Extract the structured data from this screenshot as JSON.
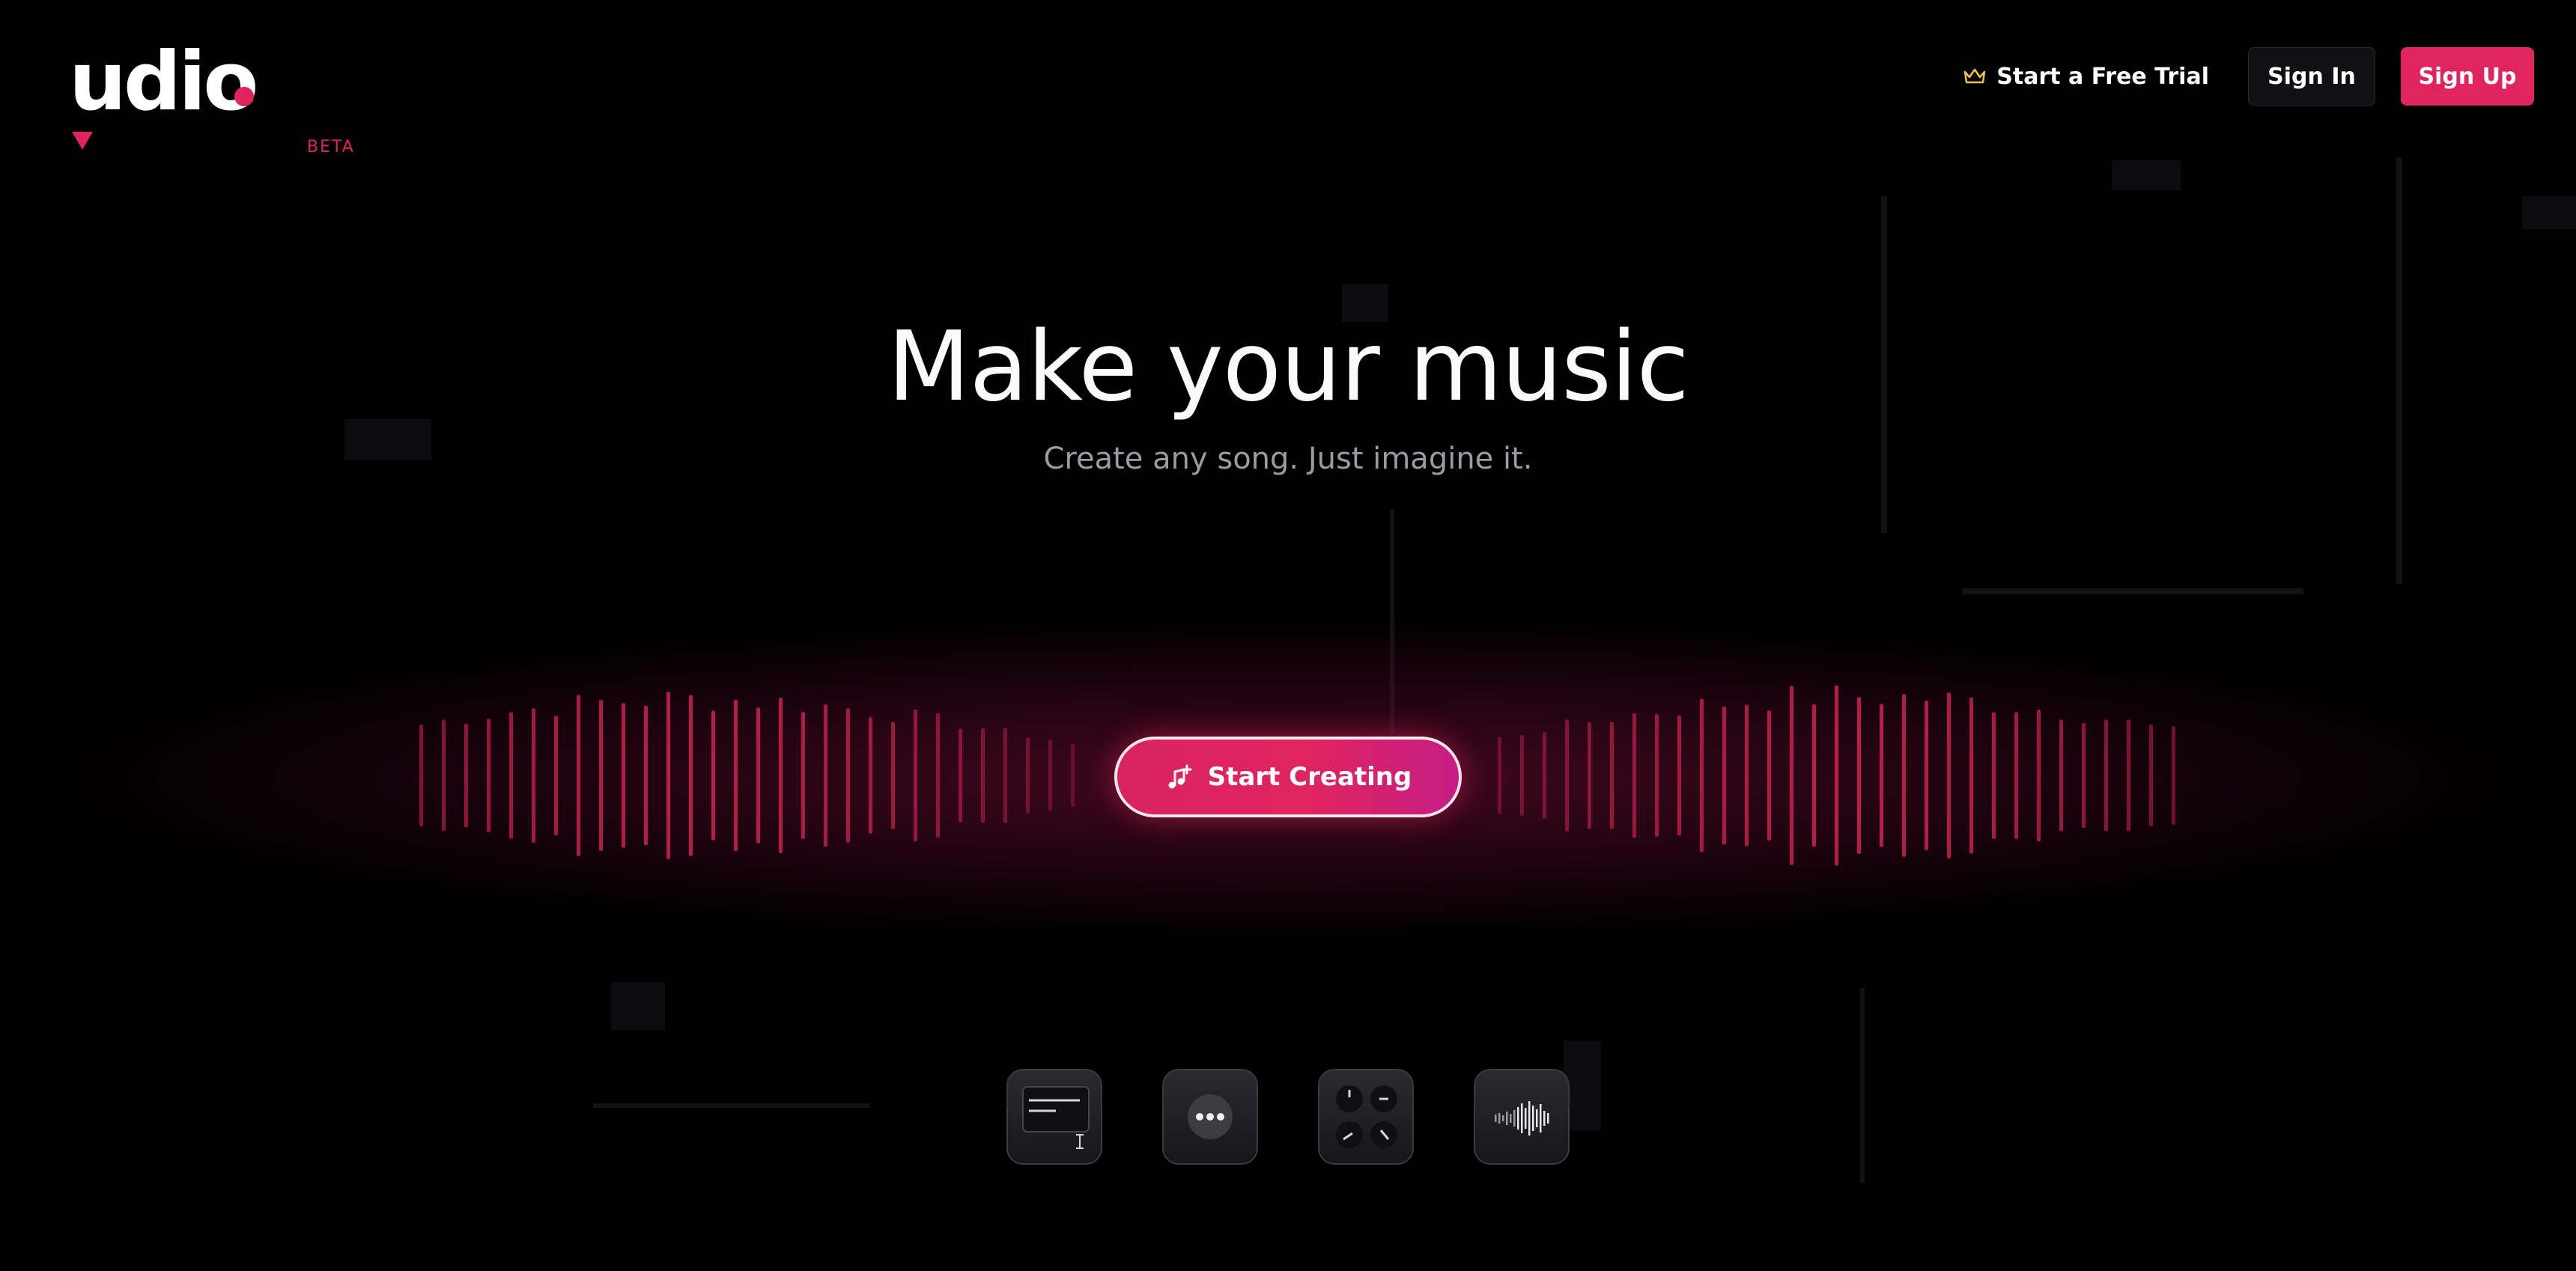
{
  "brand": {
    "name": "udio",
    "badge": "BETA",
    "accent_color": "#e0245e"
  },
  "nav": {
    "trial_label": "Start a Free Trial",
    "trial_icon": "crown-icon",
    "signin_label": "Sign In",
    "signup_label": "Sign Up"
  },
  "hero": {
    "title": "Make your music",
    "subtitle": "Create any song. Just imagine it.",
    "cta_label": "Start Creating",
    "cta_icon": "music-note-plus-icon"
  },
  "feature_tiles": [
    {
      "icon": "text-prompt-icon"
    },
    {
      "icon": "chat-bubble-icon"
    },
    {
      "icon": "knobs-icon"
    },
    {
      "icon": "waveform-icon"
    }
  ],
  "colors": {
    "background": "#000000",
    "accent": "#e0245e",
    "text_muted": "#9b9ba3"
  }
}
